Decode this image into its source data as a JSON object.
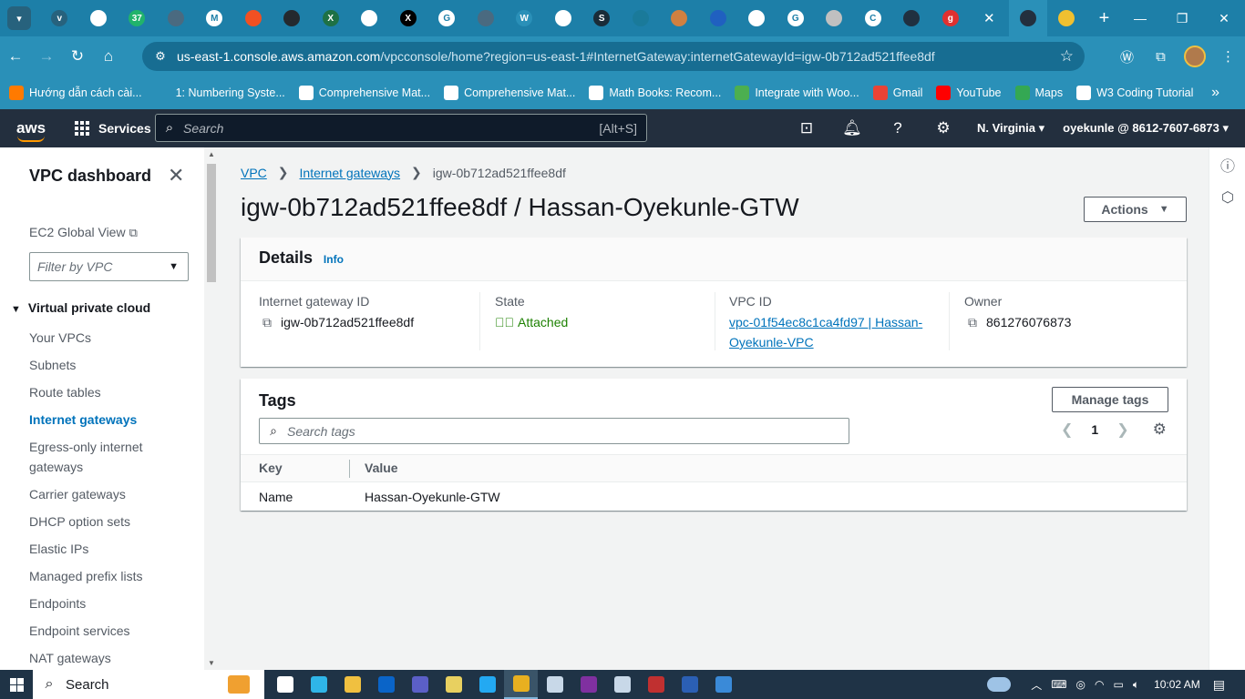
{
  "browser": {
    "tabs": [
      {
        "icon": "tab-search-icon",
        "color": "#27627d",
        "glyph": "v"
      },
      {
        "icon": "app-icon",
        "color": "#ffffff",
        "glyph": ""
      },
      {
        "icon": "badge-37-icon",
        "color": "#21b36b",
        "glyph": "37"
      },
      {
        "icon": "globe-icon",
        "color": "#4a6a80",
        "glyph": ""
      },
      {
        "icon": "gmail-icon",
        "color": "#ffffff",
        "glyph": "M"
      },
      {
        "icon": "windows-icon",
        "color": "#f25022",
        "glyph": ""
      },
      {
        "icon": "github-icon",
        "color": "#24292e",
        "glyph": ""
      },
      {
        "icon": "excel-icon",
        "color": "#1e7145",
        "glyph": "X"
      },
      {
        "icon": "chatgpt-icon",
        "color": "#ffffff",
        "glyph": ""
      },
      {
        "icon": "x-icon",
        "color": "#000000",
        "glyph": "X"
      },
      {
        "icon": "google-icon",
        "color": "#ffffff",
        "glyph": "G"
      },
      {
        "icon": "globe-icon",
        "color": "#4a6a80",
        "glyph": ""
      },
      {
        "icon": "woocommerce-icon",
        "color": "#2a90b8",
        "glyph": "W"
      },
      {
        "icon": "photo-icon",
        "color": "#ffffff",
        "glyph": ""
      },
      {
        "icon": "scribd-icon",
        "color": "#1a2c38",
        "glyph": "S"
      },
      {
        "icon": "cloud-icon",
        "color": "#1a7a9a",
        "glyph": ""
      },
      {
        "icon": "avatar-icon",
        "color": "#d08040",
        "glyph": ""
      },
      {
        "icon": "circle-icon",
        "color": "#2060c0",
        "glyph": ""
      },
      {
        "icon": "app-icon",
        "color": "#ffffff",
        "glyph": ""
      },
      {
        "icon": "google-icon",
        "color": "#ffffff",
        "glyph": "G"
      },
      {
        "icon": "avatar-icon",
        "color": "#c0c0c0",
        "glyph": ""
      },
      {
        "icon": "c-icon",
        "color": "#ffffff",
        "glyph": "C"
      },
      {
        "icon": "circle-icon",
        "color": "#203040",
        "glyph": ""
      },
      {
        "icon": "g-icon",
        "color": "#e03030",
        "glyph": "g"
      },
      {
        "icon": "close-icon",
        "color": "",
        "glyph": "✕"
      },
      {
        "icon": "aws-console-icon",
        "color": "#232f3e",
        "glyph": ""
      },
      {
        "icon": "app-icon",
        "color": "#f0c030",
        "glyph": ""
      }
    ],
    "url_host": "us-east-1.console.aws.amazon.com",
    "url_path": "/vpcconsole/home?region=us-east-1#InternetGateway:internetGatewayId=igw-0b712ad521ffee8df",
    "bookmarks": [
      {
        "label": "Hướng dẫn cách cài...",
        "color": "#ff7a00"
      },
      {
        "label": "1: Numbering Syste...",
        "color": "#2a90b8"
      },
      {
        "label": "Comprehensive Mat...",
        "color": "#ffffff"
      },
      {
        "label": "Comprehensive Mat...",
        "color": "#ffffff"
      },
      {
        "label": "Math Books: Recom...",
        "color": "#ffffff"
      },
      {
        "label": "Integrate with Woo...",
        "color": "#4caf50"
      },
      {
        "label": "Gmail",
        "color": "#ea4335"
      },
      {
        "label": "YouTube",
        "color": "#ff0000"
      },
      {
        "label": "Maps",
        "color": "#34a853"
      },
      {
        "label": "W3 Coding Tutorial",
        "color": "#ffffff"
      }
    ]
  },
  "aws": {
    "logo": "aws",
    "services": "Services",
    "search_placeholder": "Search",
    "search_shortcut": "[Alt+S]",
    "region": "N. Virginia",
    "account": "oyekunle @ 8612-7607-6873"
  },
  "sidebar": {
    "title": "VPC dashboard",
    "ec2_global_view": "EC2 Global View",
    "filter_placeholder": "Filter by VPC",
    "section": "Virtual private cloud",
    "items": [
      {
        "label": "Your VPCs",
        "active": false
      },
      {
        "label": "Subnets",
        "active": false
      },
      {
        "label": "Route tables",
        "active": false
      },
      {
        "label": "Internet gateways",
        "active": true
      },
      {
        "label": "Egress-only internet gateways",
        "active": false
      },
      {
        "label": "Carrier gateways",
        "active": false
      },
      {
        "label": "DHCP option sets",
        "active": false
      },
      {
        "label": "Elastic IPs",
        "active": false
      },
      {
        "label": "Managed prefix lists",
        "active": false
      },
      {
        "label": "Endpoints",
        "active": false
      },
      {
        "label": "Endpoint services",
        "active": false
      },
      {
        "label": "NAT gateways",
        "active": false
      }
    ]
  },
  "main": {
    "breadcrumb": {
      "root": "VPC",
      "parent": "Internet gateways",
      "current": "igw-0b712ad521ffee8df"
    },
    "title": "igw-0b712ad521ffee8df / Hassan-Oyekunle-GTW",
    "actions": "Actions",
    "details": {
      "heading": "Details",
      "info": "Info",
      "igw_label": "Internet gateway ID",
      "igw_value": "igw-0b712ad521ffee8df",
      "state_label": "State",
      "state_value": "Attached",
      "vpc_label": "VPC ID",
      "vpc_value": "vpc-01f54ec8c1ca4fd97 | Hassan-Oyekunle-VPC",
      "owner_label": "Owner",
      "owner_value": "861276076873"
    },
    "tags": {
      "heading": "Tags",
      "manage": "Manage tags",
      "search_placeholder": "Search tags",
      "page": "1",
      "col_key": "Key",
      "col_value": "Value",
      "rows": [
        {
          "key": "Name",
          "value": "Hassan-Oyekunle-GTW"
        }
      ]
    }
  },
  "taskbar": {
    "search": "Search",
    "time": "10:02 AM",
    "apps": [
      {
        "icon": "task-view-icon",
        "color": "#ffffff"
      },
      {
        "icon": "edge-icon",
        "color": "#2fb5e8"
      },
      {
        "icon": "file-explorer-icon",
        "color": "#f0c040"
      },
      {
        "icon": "outlook-icon",
        "color": "#0a64c8"
      },
      {
        "icon": "teams-icon",
        "color": "#5b5fc7"
      },
      {
        "icon": "git-icon",
        "color": "#e8d060"
      },
      {
        "icon": "vscode-icon",
        "color": "#23a9f2"
      },
      {
        "icon": "chrome-icon",
        "color": "#e8b020"
      },
      {
        "icon": "virtualbox-icon",
        "color": "#c8d8e8"
      },
      {
        "icon": "onenote-icon",
        "color": "#8030a0"
      },
      {
        "icon": "cube-icon",
        "color": "#c8d8e8"
      },
      {
        "icon": "winrar-icon",
        "color": "#c03030"
      },
      {
        "icon": "word-icon",
        "color": "#2b5fb4"
      },
      {
        "icon": "photos-icon",
        "color": "#3a8ad8"
      }
    ]
  }
}
